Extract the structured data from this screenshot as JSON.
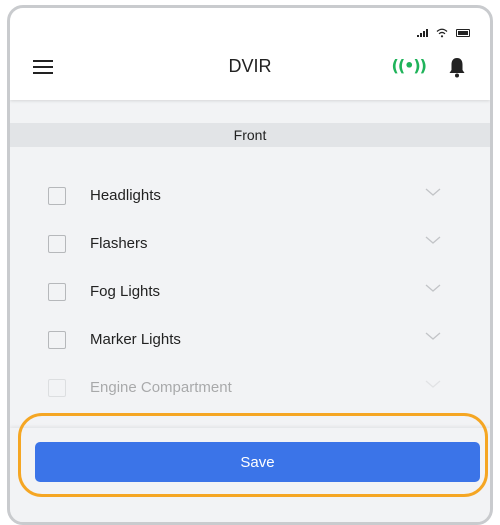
{
  "header": {
    "title": "DVIR",
    "left_icon": "hamburger-menu-icon",
    "right_icons": [
      "broadcast-signal-icon",
      "bell-icon"
    ],
    "signal_glyph": "((•))",
    "signal_color": "#1fb35a"
  },
  "status_bar": {
    "icons": [
      "cellular-signal-icon",
      "wifi-icon",
      "battery-icon"
    ]
  },
  "section": {
    "title": "Front"
  },
  "checklist": {
    "items": [
      {
        "label": "Headlights",
        "checked": false
      },
      {
        "label": "Flashers",
        "checked": false
      },
      {
        "label": "Fog Lights",
        "checked": false
      },
      {
        "label": "Marker Lights",
        "checked": false
      },
      {
        "label": "Engine Compartment",
        "checked": false
      }
    ]
  },
  "footer": {
    "save_label": "Save",
    "save_color": "#3b74e8",
    "highlight_color": "#f5a623"
  }
}
